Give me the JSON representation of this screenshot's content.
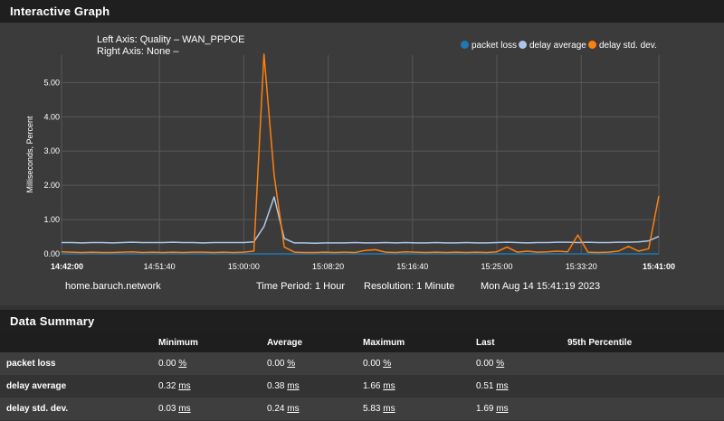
{
  "panel_title": "Interactive Graph",
  "left_axis": "Left Axis: Quality – WAN_PPPOE",
  "right_axis": "Right Axis: None –",
  "legend": [
    {
      "label": "packet loss",
      "color": "#1f77b4"
    },
    {
      "label": "delay average",
      "color": "#aec7e8"
    },
    {
      "label": "delay std. dev.",
      "color": "#ff7f0e"
    }
  ],
  "footer": {
    "host": "home.baruch.network",
    "period": "Time Period: 1 Hour",
    "resolution": "Resolution: 1 Minute",
    "timestamp": "Mon Aug 14 15:41:19 2023"
  },
  "chart_data": {
    "type": "line",
    "ylabel": "Milliseconds, Percent",
    "ylim": [
      0,
      5.8
    ],
    "yticks": [
      "0.00",
      "1.00",
      "2.00",
      "3.00",
      "4.00",
      "5.00"
    ],
    "xlim": [
      "14:42:00",
      "15:41:00"
    ],
    "xtick_labels": [
      "14:42:00",
      "14:51:40",
      "15:00:00",
      "15:08:20",
      "15:16:40",
      "15:25:00",
      "15:33:20",
      "15:41:00"
    ],
    "x": [
      "14:42",
      "14:43",
      "14:44",
      "14:45",
      "14:46",
      "14:47",
      "14:48",
      "14:49",
      "14:50",
      "14:51",
      "14:52",
      "14:53",
      "14:54",
      "14:55",
      "14:56",
      "14:57",
      "14:58",
      "14:59",
      "15:00",
      "15:01",
      "15:02",
      "15:03",
      "15:04",
      "15:05",
      "15:06",
      "15:07",
      "15:08",
      "15:09",
      "15:10",
      "15:11",
      "15:12",
      "15:13",
      "15:14",
      "15:15",
      "15:16",
      "15:17",
      "15:18",
      "15:19",
      "15:20",
      "15:21",
      "15:22",
      "15:23",
      "15:24",
      "15:25",
      "15:26",
      "15:27",
      "15:28",
      "15:29",
      "15:30",
      "15:31",
      "15:32",
      "15:33",
      "15:34",
      "15:35",
      "15:36",
      "15:37",
      "15:38",
      "15:39",
      "15:40",
      "15:41"
    ],
    "series": [
      {
        "name": "packet loss",
        "color": "#1f77b4",
        "values": [
          0,
          0,
          0,
          0,
          0,
          0,
          0,
          0,
          0,
          0,
          0,
          0,
          0,
          0,
          0,
          0,
          0,
          0,
          0,
          0,
          0,
          0,
          0,
          0,
          0,
          0,
          0,
          0,
          0,
          0,
          0,
          0,
          0,
          0,
          0,
          0,
          0,
          0,
          0,
          0,
          0,
          0,
          0,
          0,
          0,
          0,
          0,
          0,
          0,
          0,
          0,
          0,
          0,
          0,
          0,
          0,
          0,
          0,
          0,
          0
        ]
      },
      {
        "name": "delay average",
        "color": "#aec7e8",
        "values": [
          0.33,
          0.33,
          0.32,
          0.33,
          0.33,
          0.32,
          0.33,
          0.34,
          0.33,
          0.33,
          0.33,
          0.34,
          0.33,
          0.33,
          0.32,
          0.33,
          0.33,
          0.33,
          0.33,
          0.35,
          0.8,
          1.66,
          0.45,
          0.32,
          0.32,
          0.31,
          0.32,
          0.32,
          0.32,
          0.33,
          0.32,
          0.32,
          0.33,
          0.32,
          0.33,
          0.32,
          0.32,
          0.33,
          0.32,
          0.32,
          0.33,
          0.32,
          0.32,
          0.33,
          0.34,
          0.33,
          0.32,
          0.33,
          0.33,
          0.34,
          0.34,
          0.33,
          0.34,
          0.33,
          0.33,
          0.34,
          0.34,
          0.35,
          0.38,
          0.51
        ]
      },
      {
        "name": "delay std. dev.",
        "color": "#ff7f0e",
        "values": [
          0.06,
          0.05,
          0.04,
          0.05,
          0.04,
          0.04,
          0.05,
          0.06,
          0.04,
          0.05,
          0.04,
          0.05,
          0.04,
          0.05,
          0.05,
          0.04,
          0.05,
          0.04,
          0.05,
          0.08,
          5.83,
          2.3,
          0.2,
          0.05,
          0.04,
          0.04,
          0.05,
          0.04,
          0.05,
          0.04,
          0.1,
          0.12,
          0.05,
          0.04,
          0.06,
          0.05,
          0.04,
          0.05,
          0.04,
          0.05,
          0.04,
          0.05,
          0.04,
          0.06,
          0.2,
          0.05,
          0.08,
          0.05,
          0.06,
          0.08,
          0.06,
          0.55,
          0.05,
          0.04,
          0.05,
          0.08,
          0.22,
          0.08,
          0.15,
          1.69
        ]
      }
    ]
  },
  "summary": {
    "title": "Data Summary",
    "headers": [
      "",
      "Minimum",
      "Average",
      "Maximum",
      "Last",
      "95th Percentile"
    ],
    "rows": [
      {
        "name": "packet loss",
        "min": "0.00",
        "avg": "0.00",
        "max": "0.00",
        "last": "0.00",
        "p95": "",
        "unit": "%"
      },
      {
        "name": "delay average",
        "min": "0.32",
        "avg": "0.38",
        "max": "1.66",
        "last": "0.51",
        "p95": "",
        "unit": "ms"
      },
      {
        "name": "delay std. dev.",
        "min": "0.03",
        "avg": "0.24",
        "max": "5.83",
        "last": "1.69",
        "p95": "",
        "unit": "ms"
      }
    ]
  }
}
